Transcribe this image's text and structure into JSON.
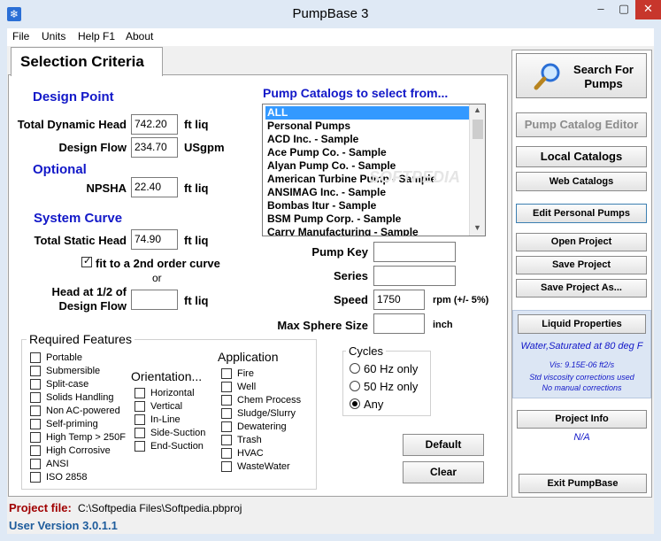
{
  "window": {
    "title": "PumpBase 3",
    "minimize": "–",
    "maximize": "▢",
    "close": "✕",
    "app_icon": "❄"
  },
  "menu": [
    "File",
    "Units",
    "Help F1",
    "About"
  ],
  "tab": {
    "label": "Selection Criteria"
  },
  "design_point": {
    "header": "Design Point",
    "tdh_label": "Total Dynamic Head",
    "tdh_value": "742.20",
    "tdh_unit": "ft liq",
    "flow_label": "Design Flow",
    "flow_value": "234.70",
    "flow_unit": "USgpm"
  },
  "optional": {
    "header": "Optional",
    "npsha_label": "NPSHA",
    "npsha_value": "22.40",
    "npsha_unit": "ft liq"
  },
  "system_curve": {
    "header": "System Curve",
    "static_label": "Total Static Head",
    "static_value": "74.90",
    "static_unit": "ft liq",
    "fit_label": "fit to a 2nd order curve",
    "fit_checked": true,
    "or_label": "or",
    "half_label_1": "Head at 1/2 of",
    "half_label_2": "Design Flow",
    "half_value": "",
    "half_unit": "ft liq"
  },
  "catalogs": {
    "header": "Pump Catalogs to select from...",
    "items": [
      "ALL",
      "Personal Pumps",
      "ACD Inc. - Sample",
      "Ace Pump Co. - Sample",
      "Alyan Pump Co. - Sample",
      "American Turbine Pump - Sample",
      "ANSIMAG Inc. - Sample",
      "Bombas Itur - Sample",
      "BSM Pump Corp. - Sample",
      "Carry Manufacturing - Sample"
    ],
    "selected_index": 0,
    "watermark": "SOFTPEDIA"
  },
  "filters": {
    "pump_key_label": "Pump Key",
    "pump_key_value": "",
    "series_label": "Series",
    "series_value": "",
    "speed_label": "Speed",
    "speed_value": "1750",
    "speed_unit": "rpm (+/- 5%)",
    "sphere_label": "Max Sphere Size",
    "sphere_value": "",
    "sphere_unit": "inch"
  },
  "required_features": {
    "title": "Required Features",
    "items": [
      "Portable",
      "Submersible",
      "Split-case",
      "Solids Handling",
      "Non AC-powered",
      "Self-priming",
      "High Temp > 250F",
      "High Corrosive",
      "ANSI",
      "ISO 2858"
    ]
  },
  "orientation": {
    "title": "Orientation...",
    "items": [
      "Horizontal",
      "Vertical",
      "In-Line",
      "Side-Suction",
      "End-Suction"
    ]
  },
  "application": {
    "title": "Application",
    "items": [
      "Fire",
      "Well",
      "Chem Process",
      "Sludge/Slurry",
      "Dewatering",
      "Trash",
      "HVAC",
      "WasteWater"
    ]
  },
  "cycles": {
    "title": "Cycles",
    "options": [
      "60 Hz only",
      "50 Hz only",
      "Any"
    ],
    "selected_index": 2
  },
  "buttons": {
    "default": "Default",
    "clear": "Clear"
  },
  "side": {
    "search_line1": "Search For",
    "search_line2": "Pumps",
    "catalog_editor": "Pump Catalog Editor",
    "local_catalogs": "Local Catalogs",
    "web_catalogs": "Web Catalogs",
    "edit_personal": "Edit Personal Pumps",
    "open_project": "Open Project",
    "save_project": "Save Project",
    "save_project_as": "Save Project As...",
    "liquid_properties": "Liquid Properties",
    "liquid_name": "Water,Saturated at  80 deg F",
    "viscosity": "Vis: 9.15E-06 ft2/s",
    "visc_note1": "Std viscosity corrections used",
    "visc_note2": "No manual corrections",
    "project_info": "Project Info",
    "project_info_value": "N/A",
    "exit": "Exit PumpBase"
  },
  "status": {
    "project_file_label": "Project file:",
    "project_file_value": "C:\\Softpedia Files\\Softpedia.pbproj",
    "version": "User Version 3.0.1.1"
  }
}
